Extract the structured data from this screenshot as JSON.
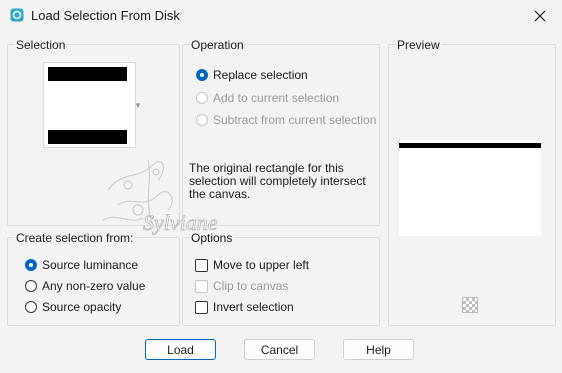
{
  "window": {
    "title": "Load Selection From Disk"
  },
  "selection": {
    "label": "Selection"
  },
  "operation": {
    "label": "Operation",
    "options": [
      {
        "label": "Replace selection",
        "checked": true,
        "enabled": true
      },
      {
        "label": "Add to current selection",
        "checked": false,
        "enabled": false
      },
      {
        "label": "Subtract from current selection",
        "checked": false,
        "enabled": false
      }
    ],
    "info": "The original rectangle for this selection will completely intersect the canvas."
  },
  "preview": {
    "label": "Preview"
  },
  "create_from": {
    "label": "Create selection from:",
    "options": [
      {
        "label": "Source luminance",
        "checked": true
      },
      {
        "label": "Any non-zero value",
        "checked": false
      },
      {
        "label": "Source opacity",
        "checked": false
      }
    ]
  },
  "options": {
    "label": "Options",
    "items": [
      {
        "label": "Move to upper left",
        "checked": false,
        "enabled": true
      },
      {
        "label": "Clip to canvas",
        "checked": false,
        "enabled": false
      },
      {
        "label": "Invert selection",
        "checked": false,
        "enabled": true
      }
    ]
  },
  "buttons": {
    "load": "Load",
    "cancel": "Cancel",
    "help": "Help"
  },
  "watermark": {
    "text": "Sylviane"
  },
  "colors": {
    "accent": "#0067c0",
    "background": "#f3f3f3"
  }
}
